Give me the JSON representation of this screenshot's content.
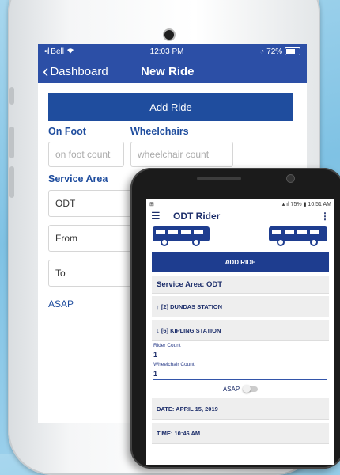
{
  "ios": {
    "status": {
      "carrier": "Bell",
      "time": "12:03 PM",
      "battery": "72%"
    },
    "nav": {
      "back_label": "Dashboard",
      "title": "New Ride"
    },
    "add_ride_label": "Add Ride",
    "on_foot_label": "On Foot",
    "wheelchairs_label": "Wheelchairs",
    "on_foot_placeholder": "on foot count",
    "wheelchairs_placeholder": "wheelchair count",
    "service_area_label": "Service Area",
    "service_area_value": "ODT",
    "from_label": "From",
    "to_label": "To",
    "asap_label": "ASAP"
  },
  "android": {
    "status": {
      "battery": "75%",
      "time": "10:51 AM"
    },
    "app_title": "ODT Rider",
    "more_icon": "⋮",
    "add_ride_label": "ADD RIDE",
    "service_area": "Service Area: ODT",
    "from_station": "↑ [2] DUNDAS STATION",
    "to_station": "↓ [6] KIPLING STATION",
    "rider_count_label": "Rider Count",
    "rider_count_value": "1",
    "wheelchair_count_label": "Wheelchair Count",
    "wheelchair_count_value": "1",
    "asap_label": "ASAP",
    "date": "DATE: APRIL 15, 2019",
    "time": "TIME: 10:46 AM"
  },
  "colors": {
    "ios_blue": "#2c4fa6",
    "android_blue": "#1e3d8f",
    "background": "#8ecbe8"
  },
  "icons": [
    "wifi-icon",
    "battery-icon",
    "chevron-left-icon",
    "menu-icon",
    "more-icon",
    "bus-icon"
  ]
}
